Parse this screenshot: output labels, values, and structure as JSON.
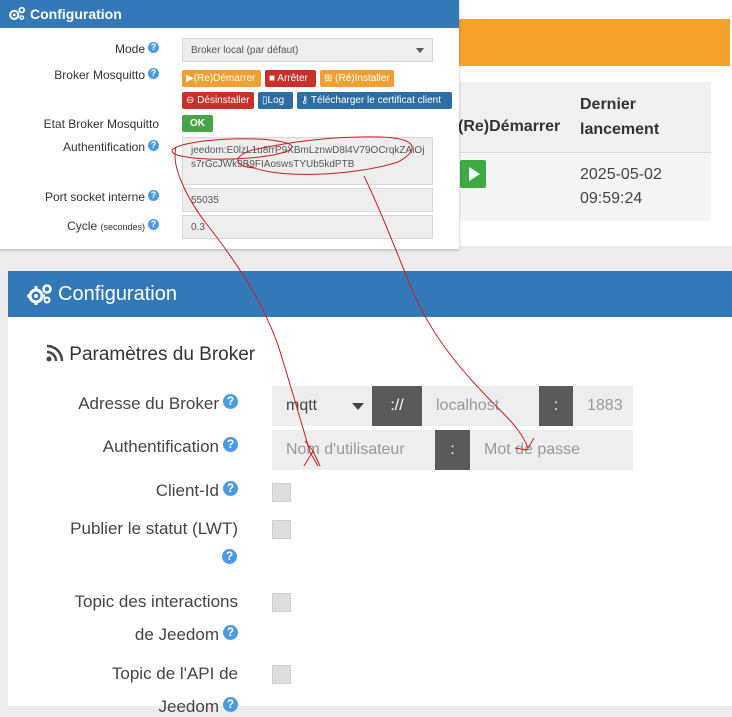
{
  "background": {
    "th_restart": "(Re)Démarrer",
    "th_last": "Dernier lancement",
    "date": "2025-05-02 09:59:24"
  },
  "small": {
    "title": "Configuration",
    "mode_label": "Mode",
    "mode_value": "Broker local (par défaut)",
    "broker_label": "Broker Mosquitto",
    "btn_restart": "(Re)Démarrer",
    "btn_stop": "Arrêter",
    "btn_install": "(Ré)Installer",
    "btn_uninstall": "Désinstaller",
    "btn_log": "Log",
    "btn_cert": "Télécharger le certificat client",
    "state_label": "Etat Broker Mosquitto",
    "state_value": "OK",
    "auth_label": "Authentification",
    "auth_value": "jeedom:E0lzL1u8rrP9XBmLznwD8l4V79OCrqkZAiOjs7rGcJWk9B9FIAoswsTYUb5kdPTB",
    "port_label": "Port socket interne",
    "port_value": "55035",
    "cycle_label": "Cycle",
    "cycle_unit": "(secondes)",
    "cycle_value": "0.3",
    "help": "?"
  },
  "big": {
    "title": "Configuration",
    "section": "Paramètres du Broker",
    "broker_label": "Adresse du Broker",
    "protocol": "mqtt",
    "sep_scheme": "://",
    "host_placeholder": "localhost",
    "sep_colon": ":",
    "port_placeholder": "1883",
    "auth_label": "Authentification",
    "user_placeholder": "Nom d'utilisateur",
    "pass_placeholder": "Mot de passe",
    "clientid_label": "Client-Id",
    "lwt_label": "Publier le statut (LWT)",
    "topic_inter_label_1": "Topic des interactions",
    "topic_inter_label_2": "de Jeedom",
    "topic_api_label_1": "Topic de l'API de",
    "topic_api_label_2": "Jeedom",
    "help": "?"
  },
  "colors": {
    "header_blue": "#3479b7",
    "orange": "#f4a22c",
    "annotation_red": "#c81e1e"
  }
}
